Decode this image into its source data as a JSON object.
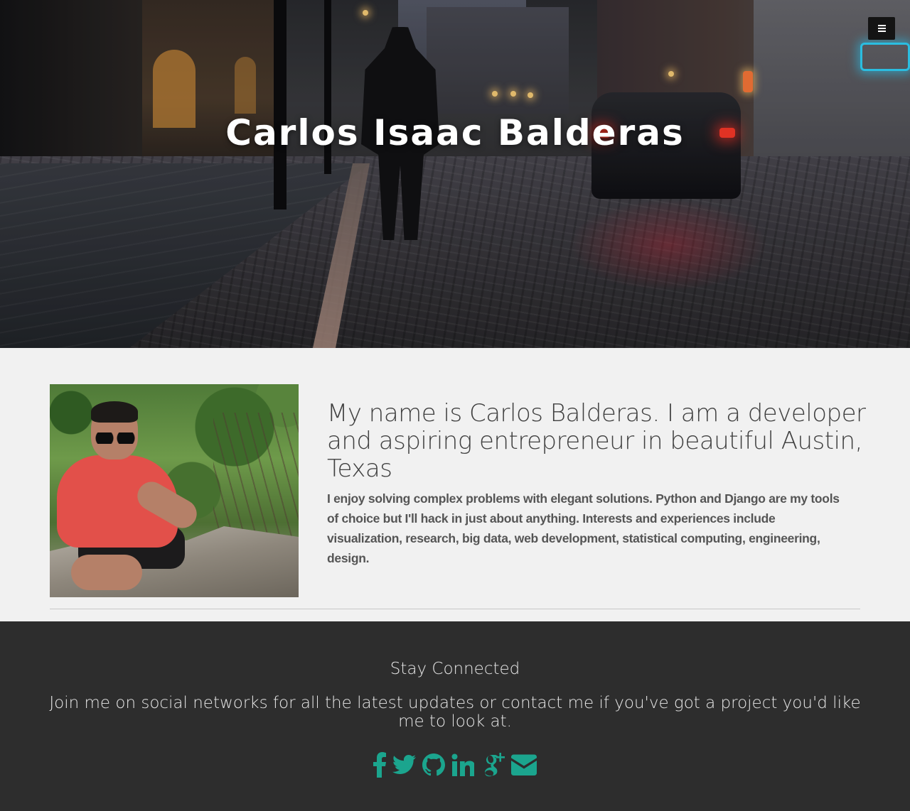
{
  "hero": {
    "title": "Carlos Isaac Balderas",
    "menu_icon": "hamburger-menu-icon"
  },
  "about": {
    "photo_alt": "Carlos Balderas portrait",
    "heading": "My name is Carlos Balderas. I am a developer and aspiring entrepreneur in beautiful Austin, Texas",
    "text": "I enjoy solving complex problems with elegant solutions. Python and Django are my tools of choice but I'll hack in just about anything. Interests and experiences include visualization, research, big data, web development, statistical computing, engineering, design."
  },
  "footer": {
    "title": "Stay Connected",
    "subtitle": "Join me on social networks for all the latest updates or contact me if you've got a project you'd like me to look at.",
    "social_links": [
      {
        "icon": "facebook-icon"
      },
      {
        "icon": "twitter-icon"
      },
      {
        "icon": "github-icon"
      },
      {
        "icon": "linkedin-icon"
      },
      {
        "icon": "google-plus-icon"
      },
      {
        "icon": "email-icon"
      }
    ],
    "icon_color": "#1ba58e"
  },
  "colors": {
    "footer_bg": "#2d2d2d",
    "about_bg": "#f1f1f1",
    "accent": "#1ba58e"
  }
}
